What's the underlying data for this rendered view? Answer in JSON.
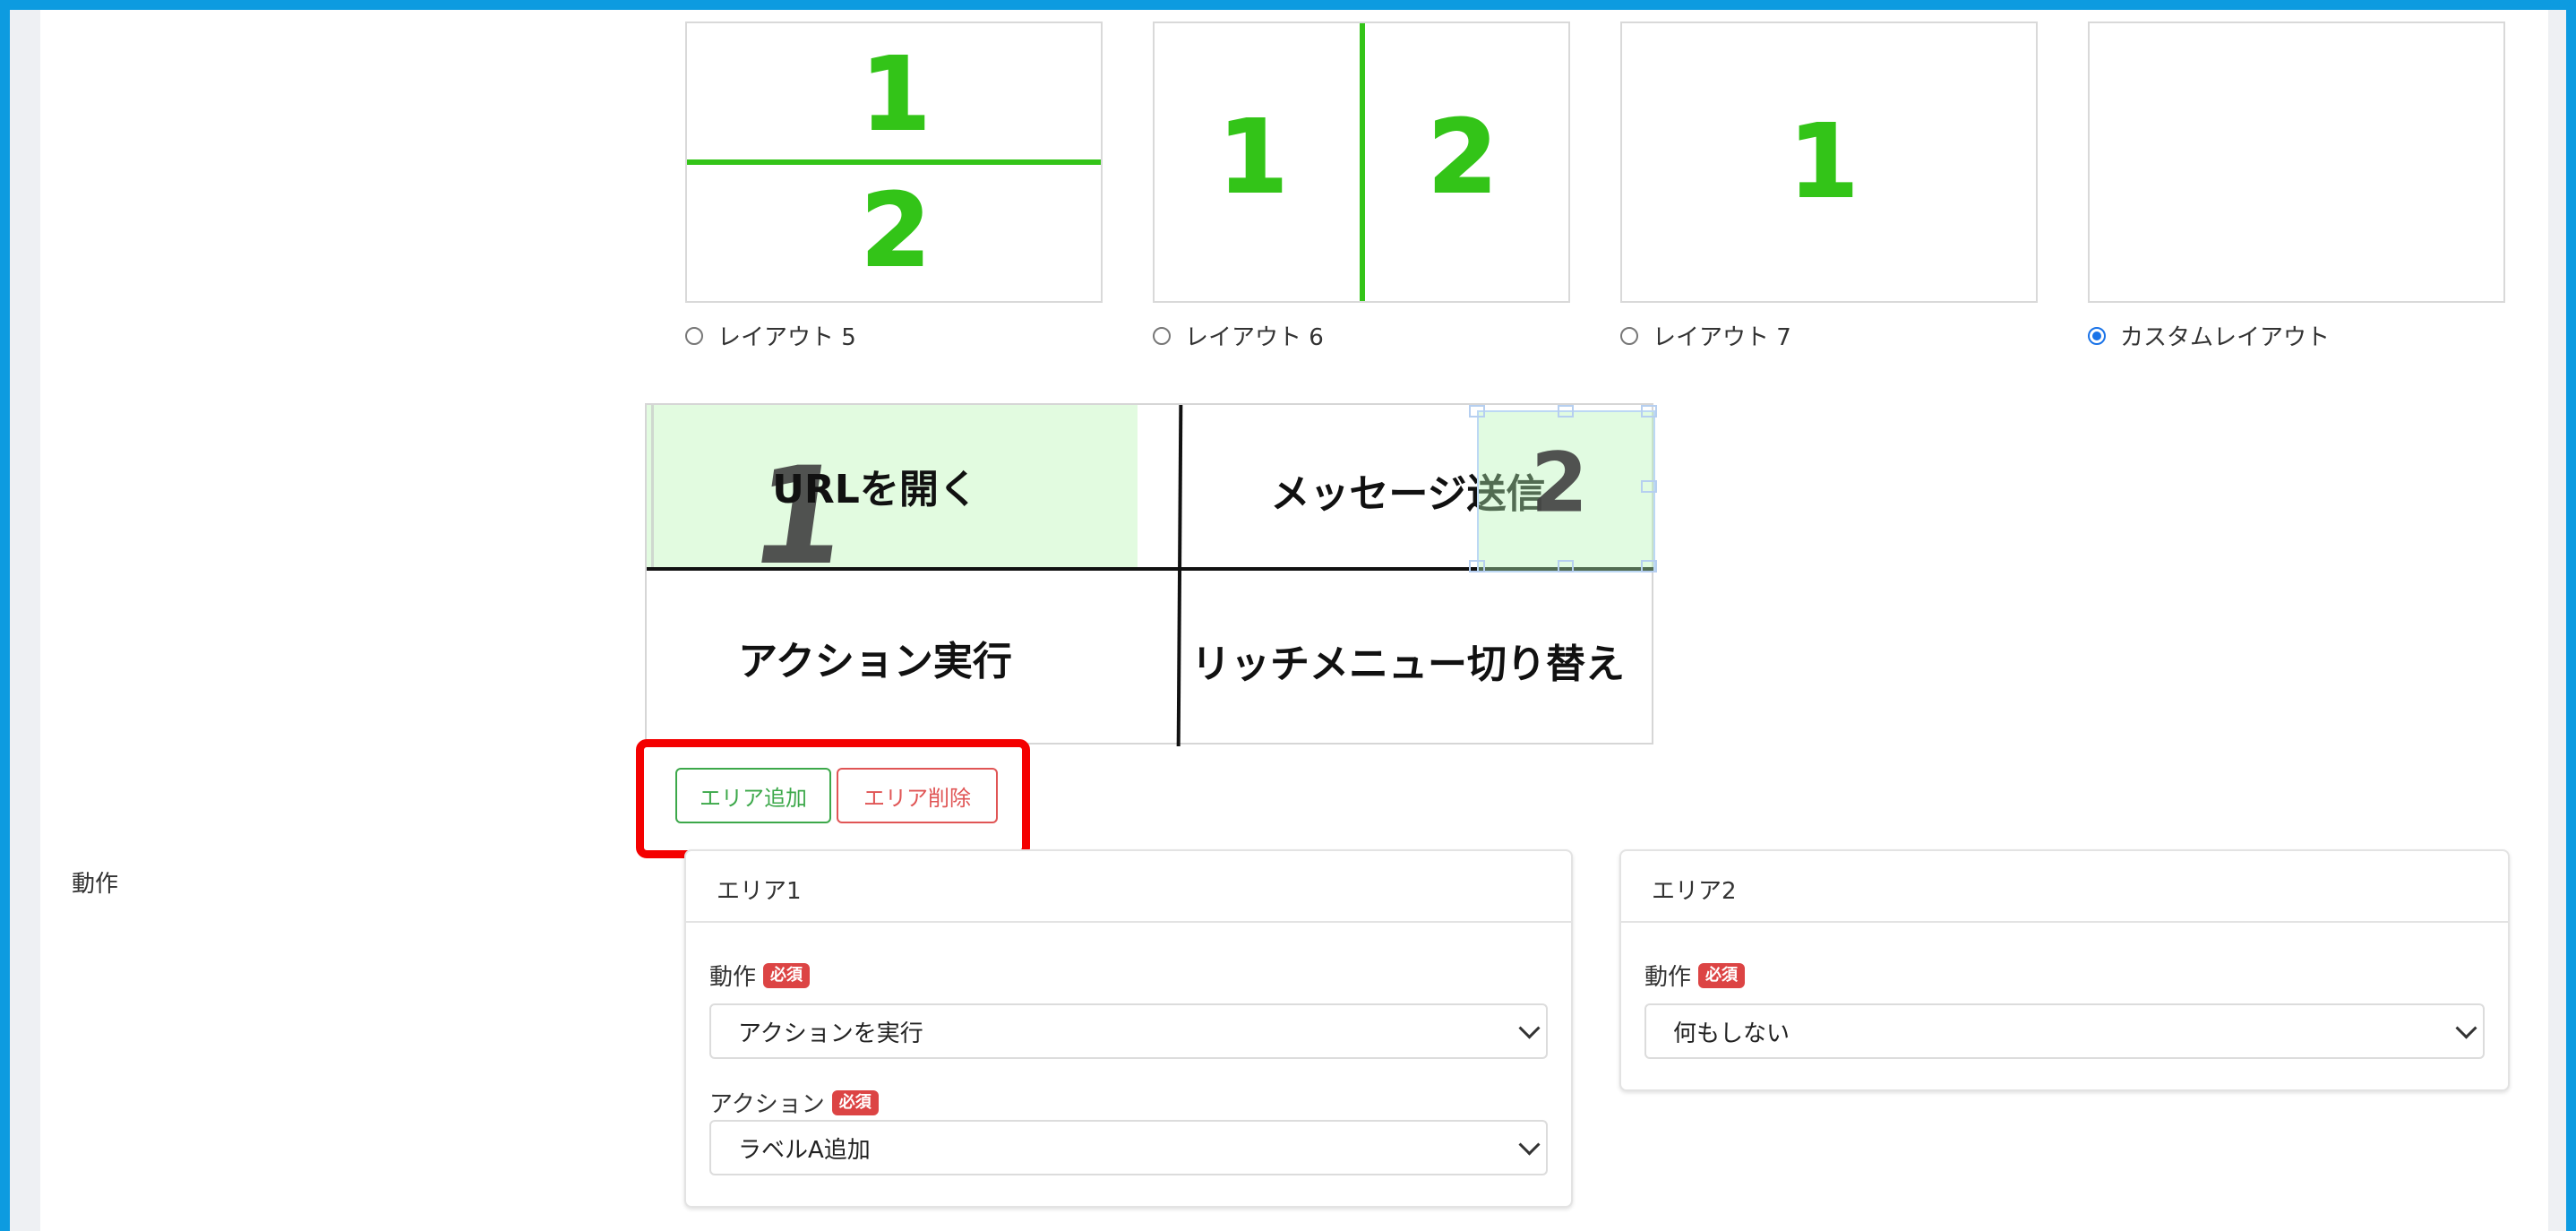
{
  "layouts": [
    {
      "label": "レイアウト 5",
      "numbers": [
        "1",
        "2"
      ],
      "checked": false
    },
    {
      "label": "レイアウト 6",
      "numbers": [
        "1",
        "2"
      ],
      "checked": false
    },
    {
      "label": "レイアウト 7",
      "numbers": [
        "1"
      ],
      "checked": false
    },
    {
      "label": "カスタムレイアウト",
      "numbers": [],
      "checked": true
    }
  ],
  "preview": {
    "cells": [
      "URLを開く",
      "メッセージ送信",
      "アクション実行",
      "リッチメニュー切り替え"
    ],
    "area_numbers": [
      "1",
      "2"
    ]
  },
  "buttons": {
    "add_area": "エリア追加",
    "delete_area": "エリア削除"
  },
  "side_label": "動作",
  "panels": [
    {
      "title": "エリア1",
      "fields": [
        {
          "label": "動作",
          "required": "必須",
          "value": "アクションを実行"
        },
        {
          "label": "アクション",
          "required": "必須",
          "value": "ラベルA追加"
        }
      ]
    },
    {
      "title": "エリア2",
      "fields": [
        {
          "label": "動作",
          "required": "必須",
          "value": "何もしない"
        }
      ]
    }
  ],
  "colors": {
    "frame": "#0d9be0",
    "accent_green": "#33c418",
    "add_button": "#3ca84a",
    "delete_button": "#e05555",
    "required_badge": "#dc4444",
    "highlight": "#f40000",
    "radio_checked": "#1a73e8"
  }
}
